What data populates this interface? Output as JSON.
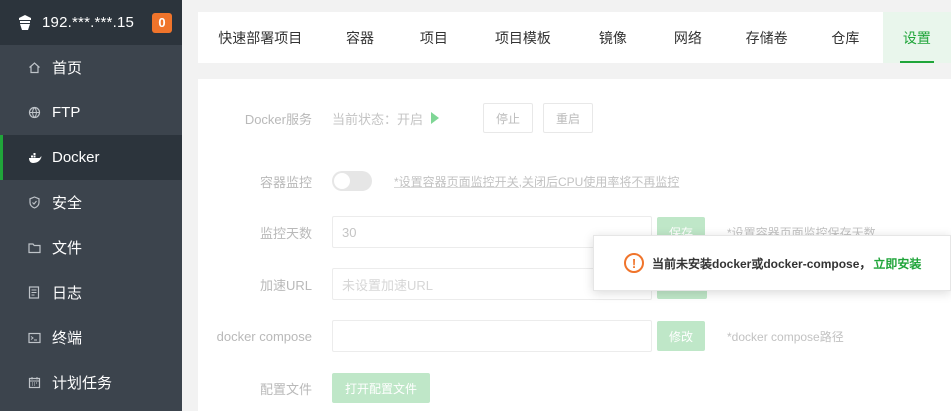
{
  "sidebar": {
    "ip": "192.***.***.15",
    "badge": "0",
    "items": [
      {
        "label": "首页",
        "icon": "home-icon"
      },
      {
        "label": "FTP",
        "icon": "globe-icon"
      },
      {
        "label": "Docker",
        "icon": "docker-icon"
      },
      {
        "label": "安全",
        "icon": "shield-icon"
      },
      {
        "label": "文件",
        "icon": "folder-icon"
      },
      {
        "label": "日志",
        "icon": "log-icon"
      },
      {
        "label": "终端",
        "icon": "terminal-icon"
      },
      {
        "label": "计划任务",
        "icon": "calendar-icon"
      }
    ]
  },
  "tabs": [
    "快速部署项目",
    "容器",
    "项目",
    "项目模板",
    "镜像",
    "网络",
    "存储卷",
    "仓库",
    "设置"
  ],
  "settings": {
    "docker_service": {
      "label": "Docker服务",
      "status": "当前状态：开启",
      "stop": "停止",
      "restart": "重启"
    },
    "container_monitor": {
      "label": "容器监控",
      "hint": "*设置容器页面监控开关,关闭后CPU使用率将不再监控"
    },
    "monitor_days": {
      "label": "监控天数",
      "value": "30",
      "save": "保存",
      "hint": "*设置容器页面监控保存天数"
    },
    "accelerate_url": {
      "label": "加速URL",
      "placeholder": "未设置加速URL"
    },
    "docker_compose": {
      "label": "docker compose",
      "modify": "修改",
      "hint": "*docker compose路径"
    },
    "config_file": {
      "label": "配置文件",
      "open": "打开配置文件"
    }
  },
  "toast": {
    "message": "当前未安装docker或docker-compose，",
    "link": "立即安装"
  },
  "colors": {
    "accent": "#20a53a",
    "badge": "#f0742b",
    "sidebar": "#3c444d"
  }
}
